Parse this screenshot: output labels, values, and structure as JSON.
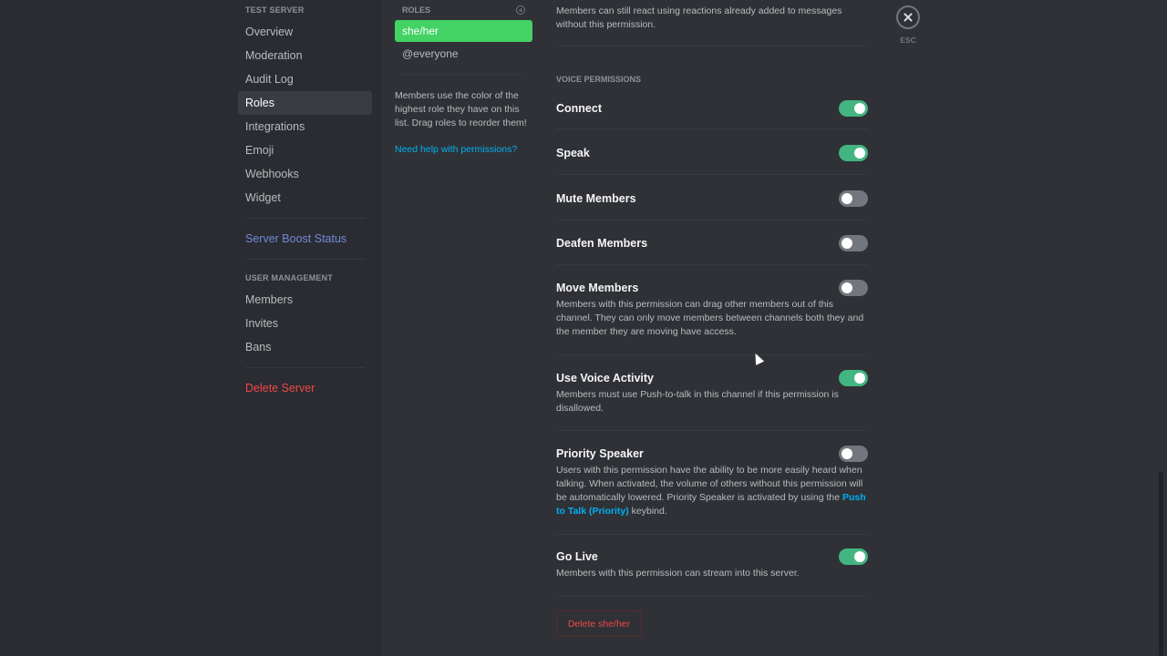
{
  "sidebar": {
    "server_header": "TEST SERVER",
    "server_items": [
      {
        "label": "Overview",
        "selected": false
      },
      {
        "label": "Moderation",
        "selected": false
      },
      {
        "label": "Audit Log",
        "selected": false
      },
      {
        "label": "Roles",
        "selected": true
      },
      {
        "label": "Integrations",
        "selected": false
      },
      {
        "label": "Emoji",
        "selected": false
      },
      {
        "label": "Webhooks",
        "selected": false
      },
      {
        "label": "Widget",
        "selected": false
      }
    ],
    "boost_label": "Server Boost Status",
    "user_mgmt_header": "USER MANAGEMENT",
    "user_items": [
      {
        "label": "Members"
      },
      {
        "label": "Invites"
      },
      {
        "label": "Bans"
      }
    ],
    "delete_server_label": "Delete Server"
  },
  "roles": {
    "header": "ROLES",
    "list": [
      {
        "name": "she/her",
        "selected": true,
        "color": "#43d264"
      },
      {
        "name": "@everyone",
        "selected": false
      }
    ],
    "info_text": "Members use the color of the highest role they have on this list. Drag roles to reorder them!",
    "help_link": "Need help with permissions?"
  },
  "permissions": {
    "top_description": "Members can still react using reactions already added to messages without this permission.",
    "voice_header": "VOICE PERMISSIONS",
    "items": [
      {
        "title": "Connect",
        "enabled": true,
        "description": ""
      },
      {
        "title": "Speak",
        "enabled": true,
        "description": ""
      },
      {
        "title": "Mute Members",
        "enabled": false,
        "description": ""
      },
      {
        "title": "Deafen Members",
        "enabled": false,
        "description": ""
      },
      {
        "title": "Move Members",
        "enabled": false,
        "description": "Members with this permission can drag other members out of this channel. They can only move members between channels both they and the member they are moving have access."
      },
      {
        "title": "Use Voice Activity",
        "enabled": true,
        "description": "Members must use Push-to-talk in this channel if this permission is disallowed."
      },
      {
        "title": "Priority Speaker",
        "enabled": false,
        "description_before": "Users with this permission have the ability to be more easily heard when talking. When activated, the volume of others without this permission will be automatically lowered. Priority Speaker is activated by using the ",
        "description_link": "Push to Talk (Priority)",
        "description_after": " keybind."
      },
      {
        "title": "Go Live",
        "enabled": true,
        "description": "Members with this permission can stream into this server."
      }
    ],
    "delete_role_label": "Delete she/her"
  },
  "close": {
    "esc_label": "ESC"
  },
  "colors": {
    "accent_green": "#43b581",
    "role_green": "#43d264",
    "danger_red": "#f04747",
    "link_blue": "#00b0f4",
    "boost_blurple": "#7289da"
  }
}
